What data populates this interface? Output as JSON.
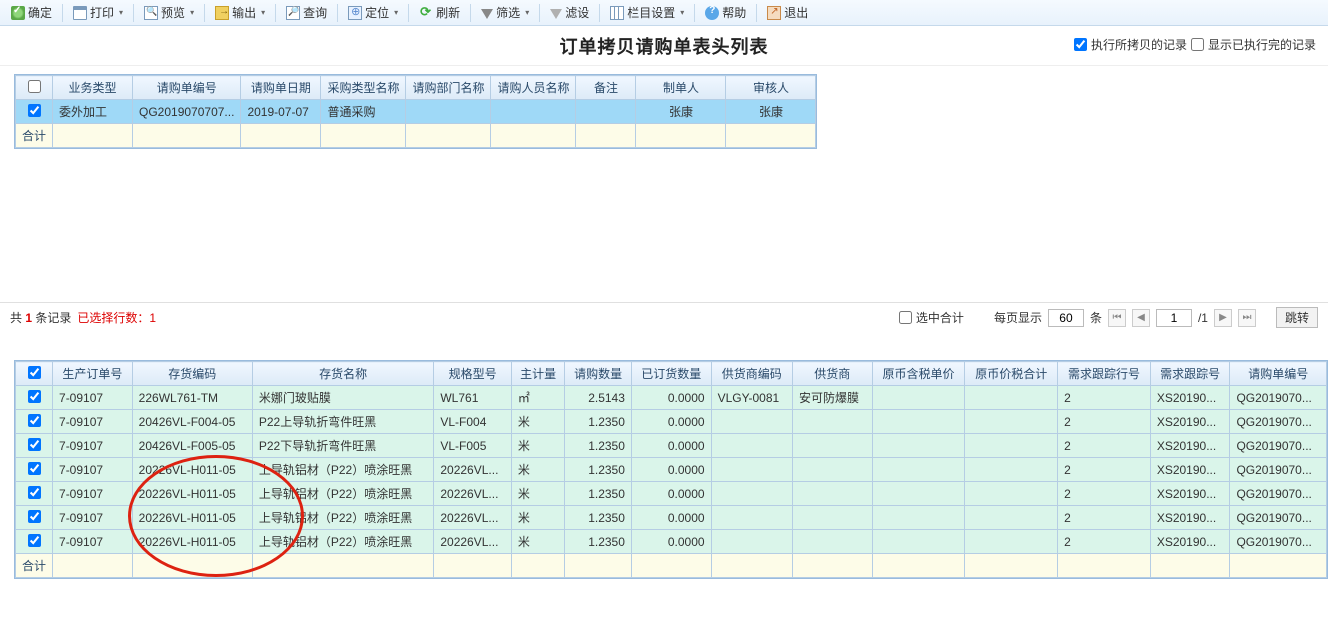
{
  "toolbar": {
    "ok": "确定",
    "print": "打印",
    "preview": "预览",
    "export": "输出",
    "query": "查询",
    "locate": "定位",
    "refresh": "刷新",
    "filter": "筛选",
    "filterSet": "滤设",
    "columns": "栏目设置",
    "help": "帮助",
    "exit": "退出"
  },
  "title": "订单拷贝请购单表头列表",
  "title_checks": {
    "exec_label": "执行所拷贝的记录",
    "show_done_label": "显示已执行完的记录",
    "exec_checked": true,
    "show_done_checked": false
  },
  "upper": {
    "headers": [
      "",
      "业务类型",
      "请购单编号",
      "请购单日期",
      "采购类型名称",
      "请购部门名称",
      "请购人员名称",
      "备注",
      "制单人",
      "审核人"
    ],
    "row": {
      "checked": true,
      "biz_type": "委外加工",
      "code": "QG2019070707...",
      "date": "2019-07-07",
      "purchase_type": "普通采购",
      "dept": "",
      "person": "",
      "remark": "",
      "maker": "张康",
      "auditor": "张康"
    },
    "total_label": "合计"
  },
  "status": {
    "total_prefix": "共 ",
    "total_count": "1",
    "total_suffix": " 条记录",
    "selected_prefix": "已选择行数：",
    "selected_count": "1",
    "check_total_label": "选中合计",
    "page_show_label": "每页显示",
    "page_size": "60",
    "page_unit": "条",
    "page_cur": "1",
    "page_total": "/1",
    "jump_label": "跳转"
  },
  "lower": {
    "headers": [
      "",
      "生产订单号",
      "存货编码",
      "存货名称",
      "规格型号",
      "主计量",
      "请购数量",
      "已订货数量",
      "供货商编码",
      "供货商",
      "原币含税单价",
      "原币价税合计",
      "需求跟踪行号",
      "需求跟踪号",
      "请购单编号"
    ],
    "rows": [
      {
        "checked": true,
        "order": "7-09107",
        "inv_code": "226WL761-TM",
        "inv_name": "米娜门玻贴膜",
        "spec": "WL761",
        "uom": "㎡",
        "qty": "2.5143",
        "ordered": "0.0000",
        "vendor_code": "VLGY-0081",
        "vendor": "安可防爆膜",
        "price": "",
        "amount": "",
        "track_line": "2",
        "track_no": "XS20190...",
        "req_code": "QG2019070..."
      },
      {
        "checked": true,
        "order": "7-09107",
        "inv_code": "20426VL-F004-05",
        "inv_name": "P22上导轨折弯件旺黑",
        "spec": "VL-F004",
        "uom": "米",
        "qty": "1.2350",
        "ordered": "0.0000",
        "vendor_code": "",
        "vendor": "",
        "price": "",
        "amount": "",
        "track_line": "2",
        "track_no": "XS20190...",
        "req_code": "QG2019070..."
      },
      {
        "checked": true,
        "order": "7-09107",
        "inv_code": "20426VL-F005-05",
        "inv_name": "P22下导轨折弯件旺黑",
        "spec": "VL-F005",
        "uom": "米",
        "qty": "1.2350",
        "ordered": "0.0000",
        "vendor_code": "",
        "vendor": "",
        "price": "",
        "amount": "",
        "track_line": "2",
        "track_no": "XS20190...",
        "req_code": "QG2019070..."
      },
      {
        "checked": true,
        "order": "7-09107",
        "inv_code": "20226VL-H011-05",
        "inv_name": "上导轨铝材（P22）喷涂旺黑",
        "spec": "20226VL...",
        "uom": "米",
        "qty": "1.2350",
        "ordered": "0.0000",
        "vendor_code": "",
        "vendor": "",
        "price": "",
        "amount": "",
        "track_line": "2",
        "track_no": "XS20190...",
        "req_code": "QG2019070..."
      },
      {
        "checked": true,
        "order": "7-09107",
        "inv_code": "20226VL-H011-05",
        "inv_name": "上导轨铝材（P22）喷涂旺黑",
        "spec": "20226VL...",
        "uom": "米",
        "qty": "1.2350",
        "ordered": "0.0000",
        "vendor_code": "",
        "vendor": "",
        "price": "",
        "amount": "",
        "track_line": "2",
        "track_no": "XS20190...",
        "req_code": "QG2019070..."
      },
      {
        "checked": true,
        "order": "7-09107",
        "inv_code": "20226VL-H011-05",
        "inv_name": "上导轨铝材（P22）喷涂旺黑",
        "spec": "20226VL...",
        "uom": "米",
        "qty": "1.2350",
        "ordered": "0.0000",
        "vendor_code": "",
        "vendor": "",
        "price": "",
        "amount": "",
        "track_line": "2",
        "track_no": "XS20190...",
        "req_code": "QG2019070..."
      },
      {
        "checked": true,
        "order": "7-09107",
        "inv_code": "20226VL-H011-05",
        "inv_name": "上导轨铝材（P22）喷涂旺黑",
        "spec": "20226VL...",
        "uom": "米",
        "qty": "1.2350",
        "ordered": "0.0000",
        "vendor_code": "",
        "vendor": "",
        "price": "",
        "amount": "",
        "track_line": "2",
        "track_no": "XS20190...",
        "req_code": "QG2019070..."
      }
    ],
    "total_label": "合计"
  }
}
